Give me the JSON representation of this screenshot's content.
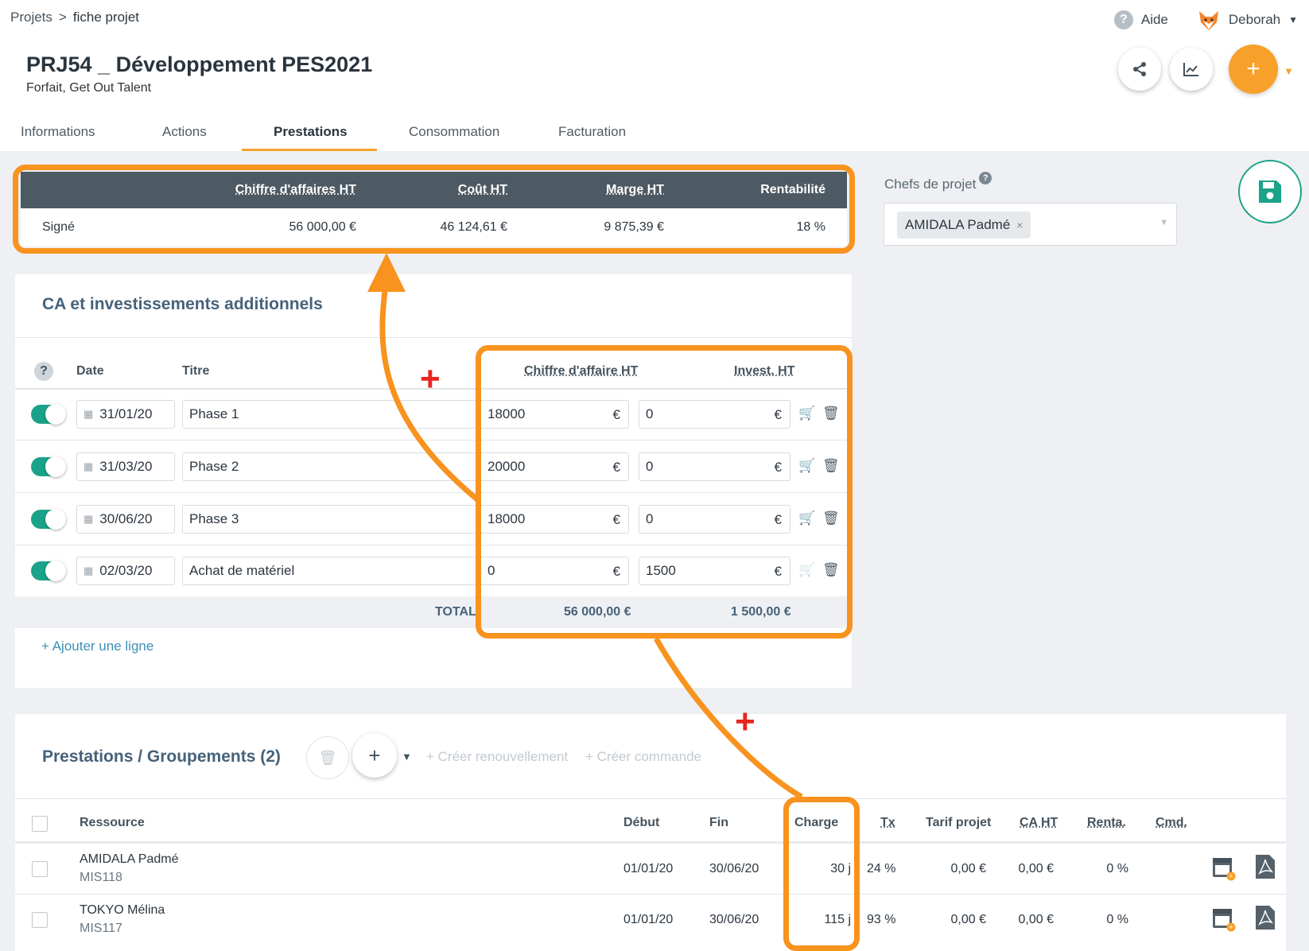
{
  "breadcrumb": {
    "root": "Projets",
    "sep": ">",
    "current": "fiche projet"
  },
  "topbar": {
    "help": "Aide",
    "user": "Deborah"
  },
  "project": {
    "title": "PRJ54 _ Développement PES2021",
    "subtitle": "Forfait, Get Out Talent"
  },
  "tabs": [
    "Informations",
    "Actions",
    "Prestations",
    "Consommation",
    "Facturation"
  ],
  "active_tab": "Prestations",
  "summary": {
    "headers": [
      "Chiffre d'affaires HT",
      "Coût HT",
      "Marge HT",
      "Rentabilité"
    ],
    "row": {
      "label": "Signé",
      "ca": "56 000,00 €",
      "cout": "46 124,61 €",
      "marge": "9 875,39 €",
      "renta": "18 %"
    }
  },
  "chefs": {
    "label": "Chefs de projet",
    "value": "AMIDALA Padmé"
  },
  "ca_section": {
    "title": "CA et investissements additionnels",
    "headers": {
      "date": "Date",
      "titre": "Titre",
      "ca": "Chiffre d'affaire HT",
      "invest": "Invest. HT"
    },
    "rows": [
      {
        "date": "31/01/20",
        "titre": "Phase 1",
        "ca": "18000",
        "invest": "0"
      },
      {
        "date": "31/03/20",
        "titre": "Phase 2",
        "ca": "20000",
        "invest": "0"
      },
      {
        "date": "30/06/20",
        "titre": "Phase 3",
        "ca": "18000",
        "invest": "0"
      },
      {
        "date": "02/03/20",
        "titre": "Achat de matériel",
        "ca": "0",
        "invest": "1500"
      }
    ],
    "currency": "€",
    "total_label": "TOTAL",
    "total_ca": "56 000,00 €",
    "total_invest": "1 500,00 €",
    "add_line": "+ Ajouter une ligne"
  },
  "prestations": {
    "title": "Prestations / Groupements (2)",
    "renew": "+ Créer renouvellement",
    "order": "+ Créer commande",
    "headers": [
      "Ressource",
      "Début",
      "Fin",
      "Charge",
      "Tx",
      "Tarif projet",
      "CA HT",
      "Renta.",
      "Cmd."
    ],
    "rows": [
      {
        "name": "AMIDALA Padmé",
        "code": "MIS118",
        "debut": "01/01/20",
        "fin": "30/06/20",
        "charge": "30 j",
        "tx": "24 %",
        "tarif": "0,00 €",
        "ca": "0,00 €",
        "renta": "0 %"
      },
      {
        "name": "TOKYO Mélina",
        "code": "MIS117",
        "debut": "01/01/20",
        "fin": "30/06/20",
        "charge": "115 j",
        "tx": "93 %",
        "tarif": "0,00 €",
        "ca": "0,00 €",
        "renta": "0 %"
      }
    ]
  },
  "colors": {
    "accent": "#f7931e",
    "toggle": "#1aa388",
    "header_dark": "#4e5a63",
    "annotation_plus": "#e8261f"
  },
  "icons": [
    "help-icon",
    "fox-avatar-icon",
    "share-icon",
    "chart-icon",
    "plus-icon",
    "save-icon",
    "calendar-icon",
    "cart-icon",
    "trash-icon",
    "pdf-icon",
    "calendar-edit-icon"
  ]
}
